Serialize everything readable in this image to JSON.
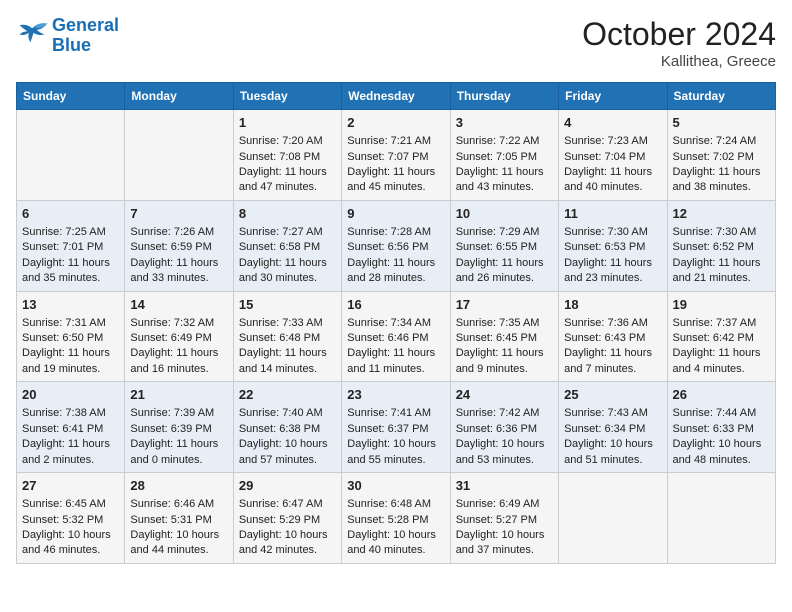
{
  "header": {
    "logo_line1": "General",
    "logo_line2": "Blue",
    "month": "October 2024",
    "location": "Kallithea, Greece"
  },
  "weekdays": [
    "Sunday",
    "Monday",
    "Tuesday",
    "Wednesday",
    "Thursday",
    "Friday",
    "Saturday"
  ],
  "weeks": [
    [
      {
        "day": "",
        "content": ""
      },
      {
        "day": "",
        "content": ""
      },
      {
        "day": "1",
        "content": "Sunrise: 7:20 AM\nSunset: 7:08 PM\nDaylight: 11 hours and 47 minutes."
      },
      {
        "day": "2",
        "content": "Sunrise: 7:21 AM\nSunset: 7:07 PM\nDaylight: 11 hours and 45 minutes."
      },
      {
        "day": "3",
        "content": "Sunrise: 7:22 AM\nSunset: 7:05 PM\nDaylight: 11 hours and 43 minutes."
      },
      {
        "day": "4",
        "content": "Sunrise: 7:23 AM\nSunset: 7:04 PM\nDaylight: 11 hours and 40 minutes."
      },
      {
        "day": "5",
        "content": "Sunrise: 7:24 AM\nSunset: 7:02 PM\nDaylight: 11 hours and 38 minutes."
      }
    ],
    [
      {
        "day": "6",
        "content": "Sunrise: 7:25 AM\nSunset: 7:01 PM\nDaylight: 11 hours and 35 minutes."
      },
      {
        "day": "7",
        "content": "Sunrise: 7:26 AM\nSunset: 6:59 PM\nDaylight: 11 hours and 33 minutes."
      },
      {
        "day": "8",
        "content": "Sunrise: 7:27 AM\nSunset: 6:58 PM\nDaylight: 11 hours and 30 minutes."
      },
      {
        "day": "9",
        "content": "Sunrise: 7:28 AM\nSunset: 6:56 PM\nDaylight: 11 hours and 28 minutes."
      },
      {
        "day": "10",
        "content": "Sunrise: 7:29 AM\nSunset: 6:55 PM\nDaylight: 11 hours and 26 minutes."
      },
      {
        "day": "11",
        "content": "Sunrise: 7:30 AM\nSunset: 6:53 PM\nDaylight: 11 hours and 23 minutes."
      },
      {
        "day": "12",
        "content": "Sunrise: 7:30 AM\nSunset: 6:52 PM\nDaylight: 11 hours and 21 minutes."
      }
    ],
    [
      {
        "day": "13",
        "content": "Sunrise: 7:31 AM\nSunset: 6:50 PM\nDaylight: 11 hours and 19 minutes."
      },
      {
        "day": "14",
        "content": "Sunrise: 7:32 AM\nSunset: 6:49 PM\nDaylight: 11 hours and 16 minutes."
      },
      {
        "day": "15",
        "content": "Sunrise: 7:33 AM\nSunset: 6:48 PM\nDaylight: 11 hours and 14 minutes."
      },
      {
        "day": "16",
        "content": "Sunrise: 7:34 AM\nSunset: 6:46 PM\nDaylight: 11 hours and 11 minutes."
      },
      {
        "day": "17",
        "content": "Sunrise: 7:35 AM\nSunset: 6:45 PM\nDaylight: 11 hours and 9 minutes."
      },
      {
        "day": "18",
        "content": "Sunrise: 7:36 AM\nSunset: 6:43 PM\nDaylight: 11 hours and 7 minutes."
      },
      {
        "day": "19",
        "content": "Sunrise: 7:37 AM\nSunset: 6:42 PM\nDaylight: 11 hours and 4 minutes."
      }
    ],
    [
      {
        "day": "20",
        "content": "Sunrise: 7:38 AM\nSunset: 6:41 PM\nDaylight: 11 hours and 2 minutes."
      },
      {
        "day": "21",
        "content": "Sunrise: 7:39 AM\nSunset: 6:39 PM\nDaylight: 11 hours and 0 minutes."
      },
      {
        "day": "22",
        "content": "Sunrise: 7:40 AM\nSunset: 6:38 PM\nDaylight: 10 hours and 57 minutes."
      },
      {
        "day": "23",
        "content": "Sunrise: 7:41 AM\nSunset: 6:37 PM\nDaylight: 10 hours and 55 minutes."
      },
      {
        "day": "24",
        "content": "Sunrise: 7:42 AM\nSunset: 6:36 PM\nDaylight: 10 hours and 53 minutes."
      },
      {
        "day": "25",
        "content": "Sunrise: 7:43 AM\nSunset: 6:34 PM\nDaylight: 10 hours and 51 minutes."
      },
      {
        "day": "26",
        "content": "Sunrise: 7:44 AM\nSunset: 6:33 PM\nDaylight: 10 hours and 48 minutes."
      }
    ],
    [
      {
        "day": "27",
        "content": "Sunrise: 6:45 AM\nSunset: 5:32 PM\nDaylight: 10 hours and 46 minutes."
      },
      {
        "day": "28",
        "content": "Sunrise: 6:46 AM\nSunset: 5:31 PM\nDaylight: 10 hours and 44 minutes."
      },
      {
        "day": "29",
        "content": "Sunrise: 6:47 AM\nSunset: 5:29 PM\nDaylight: 10 hours and 42 minutes."
      },
      {
        "day": "30",
        "content": "Sunrise: 6:48 AM\nSunset: 5:28 PM\nDaylight: 10 hours and 40 minutes."
      },
      {
        "day": "31",
        "content": "Sunrise: 6:49 AM\nSunset: 5:27 PM\nDaylight: 10 hours and 37 minutes."
      },
      {
        "day": "",
        "content": ""
      },
      {
        "day": "",
        "content": ""
      }
    ]
  ]
}
